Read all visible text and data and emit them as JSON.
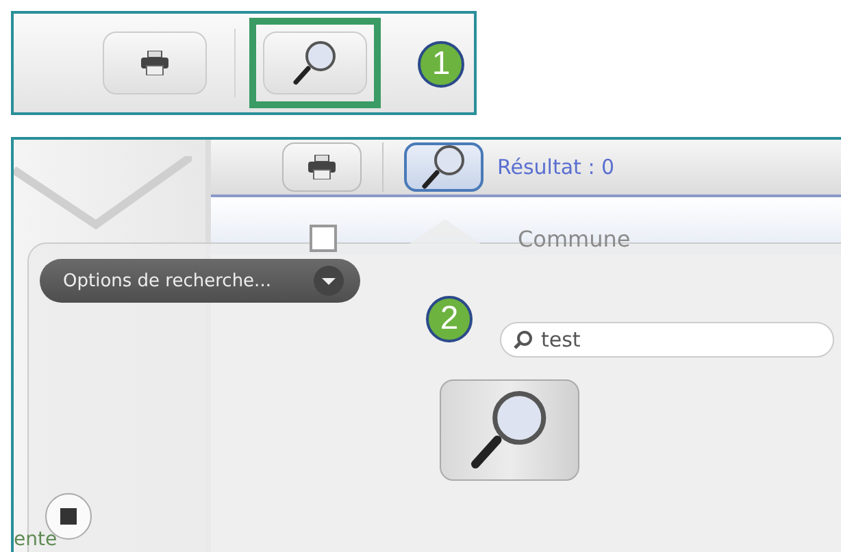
{
  "step_1": {
    "callout": "1",
    "toolbar": {
      "buttons": [
        {
          "kind": "print",
          "selected": false
        },
        {
          "kind": "search",
          "selected": true
        }
      ]
    }
  },
  "step_2": {
    "callout": "2",
    "toolbar": {
      "buttons": [
        {
          "kind": "print",
          "selected": false
        },
        {
          "kind": "search",
          "selected": true
        }
      ],
      "result": "Résultat : 0"
    },
    "table": {
      "columns": [
        "Commune"
      ],
      "select_all": {
        "checked": false
      }
    },
    "popup": {
      "options_button": "Options de recherche...",
      "search": {
        "value": "test"
      }
    },
    "footer_text": "ente"
  }
}
